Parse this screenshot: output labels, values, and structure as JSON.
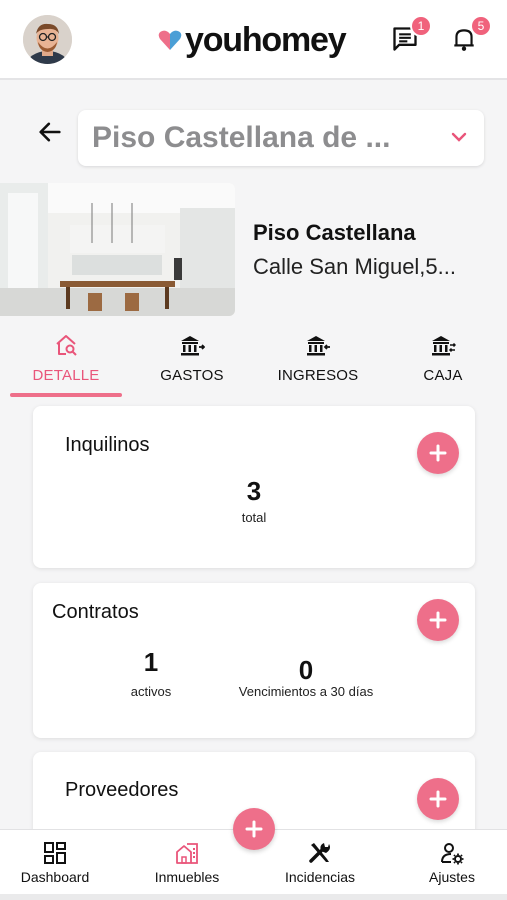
{
  "header": {
    "logo_text": "youhomey",
    "messages_badge": "1",
    "notifications_badge": "5"
  },
  "property": {
    "selector_text": "Piso Castellana de ...",
    "name": "Piso Castellana",
    "address": "Calle San Miguel,5..."
  },
  "tabs": [
    {
      "label": "DETALLE",
      "icon": "house-search-icon",
      "active": true
    },
    {
      "label": "GASTOS",
      "icon": "bank-out-icon",
      "active": false
    },
    {
      "label": "INGRESOS",
      "icon": "bank-in-icon",
      "active": false
    },
    {
      "label": "CAJA",
      "icon": "bank-exchange-icon",
      "active": false
    }
  ],
  "cards": {
    "inquilinos": {
      "title": "Inquilinos",
      "count": "3",
      "count_label": "total"
    },
    "contratos": {
      "title": "Contratos",
      "active_count": "1",
      "active_label": "activos",
      "expiring_count": "0",
      "expiring_label": "Vencimientos a 30 días"
    },
    "proveedores": {
      "title": "Proveedores"
    }
  },
  "bottom_nav": [
    {
      "label": "Dashboard",
      "icon": "dashboard-icon",
      "active": false
    },
    {
      "label": "Inmuebles",
      "icon": "building-icon",
      "active": true
    },
    {
      "label": "Incidencias",
      "icon": "tools-icon",
      "active": false
    },
    {
      "label": "Ajustes",
      "icon": "user-settings-icon",
      "active": false
    }
  ],
  "colors": {
    "accent": "#ee6f8a",
    "accent_text": "#e9557a",
    "badge": "#f0627c",
    "background": "#f5f5f6"
  }
}
